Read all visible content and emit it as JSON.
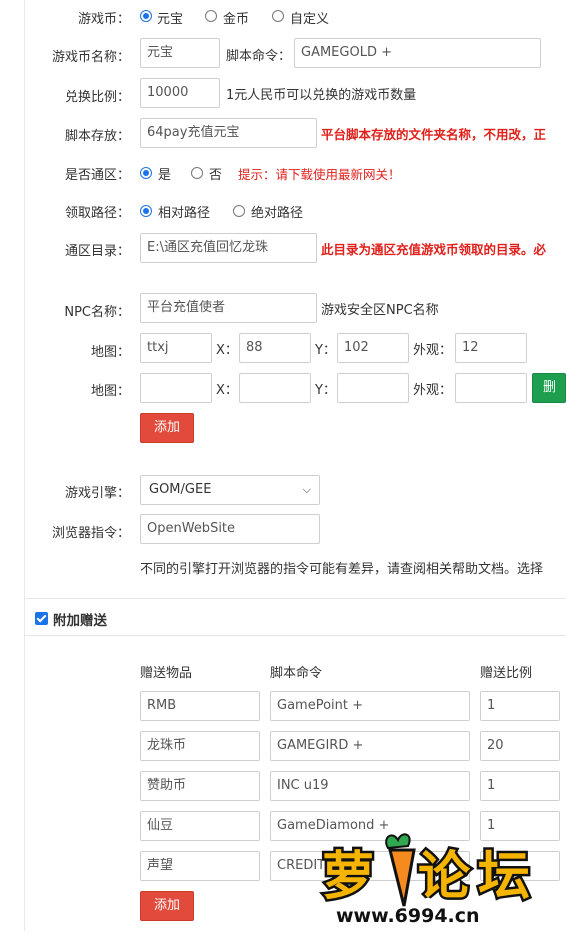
{
  "form": {
    "currency": {
      "label": "游戏币：",
      "options": [
        "元宝",
        "金币",
        "自定义"
      ],
      "selected": "元宝"
    },
    "currency_name": {
      "label": "游戏币名称：",
      "value": "元宝"
    },
    "script_cmd": {
      "label": "脚本命令：",
      "value": "GAMEGOLD +"
    },
    "ratio": {
      "label": "兑换比例：",
      "value": "10000",
      "hint": "1元人民币可以兑换的游戏币数量"
    },
    "script_store": {
      "label": "脚本存放：",
      "value": "64pay充值元宝",
      "note": "平台脚本存放的文件夹名称，不用改，正"
    },
    "common_zone": {
      "label": "是否通区：",
      "options": [
        "是",
        "否"
      ],
      "selected": "是",
      "tip": "提示：请下载使用最新网关！"
    },
    "path_mode": {
      "label": "领取路径：",
      "options": [
        "相对路径",
        "绝对路径"
      ],
      "selected": "相对路径"
    },
    "zone_dir": {
      "label": "通区目录：",
      "value": "E:\\通区充值回忆龙珠",
      "note": "此目录为通区充值游戏币领取的目录。必"
    },
    "npc": {
      "label": "NPC名称：",
      "value": "平台充值使者",
      "hint": "游戏安全区NPC名称"
    },
    "map_rows": [
      {
        "map_label": "地图：",
        "map": "ttxj",
        "x_label": "X：",
        "x": "88",
        "y_label": "Y：",
        "y": "102",
        "look_label": "外观：",
        "look": "12"
      },
      {
        "map_label": "地图：",
        "map": "",
        "x_label": "X：",
        "x": "",
        "y_label": "Y：",
        "y": "",
        "look_label": "外观：",
        "look": "",
        "delete_label": "删除"
      }
    ],
    "add_label": "添加",
    "engine": {
      "label": "游戏引擎：",
      "value": "GOM/GEE"
    },
    "browser_cmd": {
      "label": "浏览器指令：",
      "value": "OpenWebSite"
    },
    "engine_note": "不同的引擎打开浏览器的指令可能有差异，请查阅相关帮助文档。选择"
  },
  "bonus": {
    "checkbox_label": "附加赠送",
    "checked": true,
    "headers": [
      "赠送物品",
      "脚本命令",
      "赠送比例"
    ],
    "rows": [
      {
        "item": "RMB",
        "cmd": "GamePoint +",
        "ratio": "1"
      },
      {
        "item": "龙珠币",
        "cmd": "GAMEGIRD +",
        "ratio": "20"
      },
      {
        "item": "赞助币",
        "cmd": "INC u19",
        "ratio": "1"
      },
      {
        "item": "仙豆",
        "cmd": "GameDiamond +",
        "ratio": "1"
      },
      {
        "item": "声望",
        "cmd": "CREDIT +",
        "ratio": "1"
      }
    ],
    "add_label": "添加"
  },
  "watermark": {
    "text": "萝卜论坛",
    "url": "www.6994.cn"
  }
}
